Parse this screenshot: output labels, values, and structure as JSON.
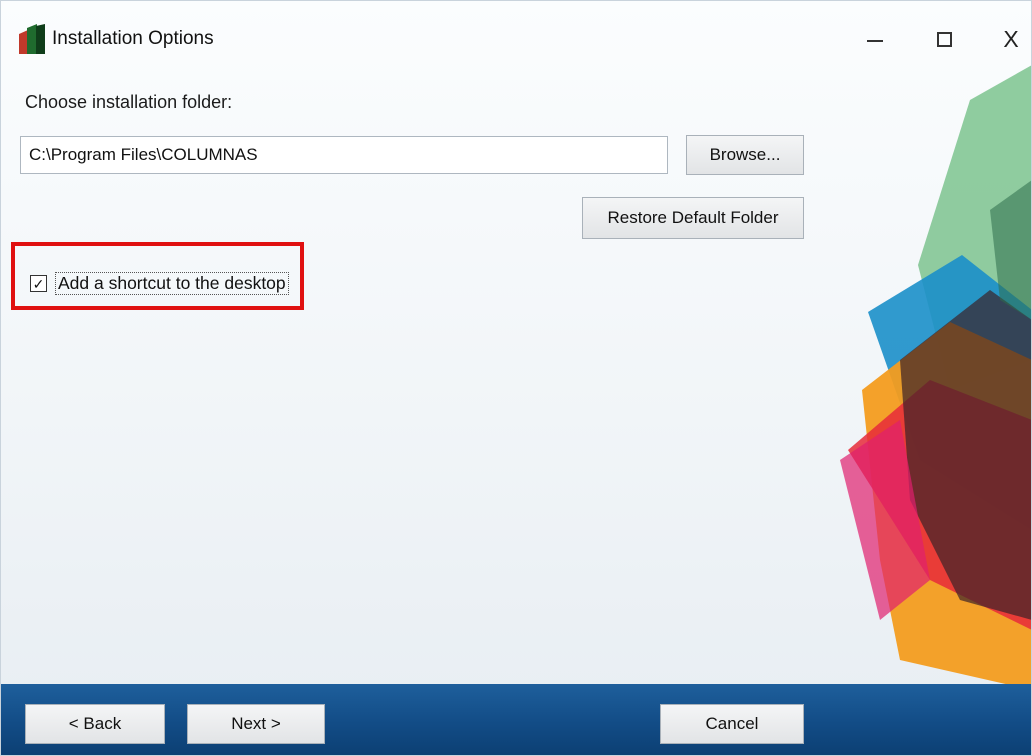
{
  "window": {
    "title": "Installation Options",
    "icon": "installer-app-icon",
    "controls": {
      "minimize_icon": "minimize-icon",
      "maximize_icon": "maximize-icon",
      "close_label": "X"
    }
  },
  "main": {
    "folder_label": "Choose installation folder:",
    "folder_path": "C:\\Program Files\\COLUMNAS",
    "browse_label": "Browse...",
    "restore_label": "Restore Default Folder",
    "shortcut": {
      "label": "Add a shortcut to the desktop",
      "checked": true,
      "check_glyph": "✓"
    }
  },
  "footer": {
    "back_label": "< Back",
    "next_label": "Next >",
    "cancel_label": "Cancel"
  },
  "colors": {
    "highlight": "#e01010",
    "footer": "#124c86"
  }
}
